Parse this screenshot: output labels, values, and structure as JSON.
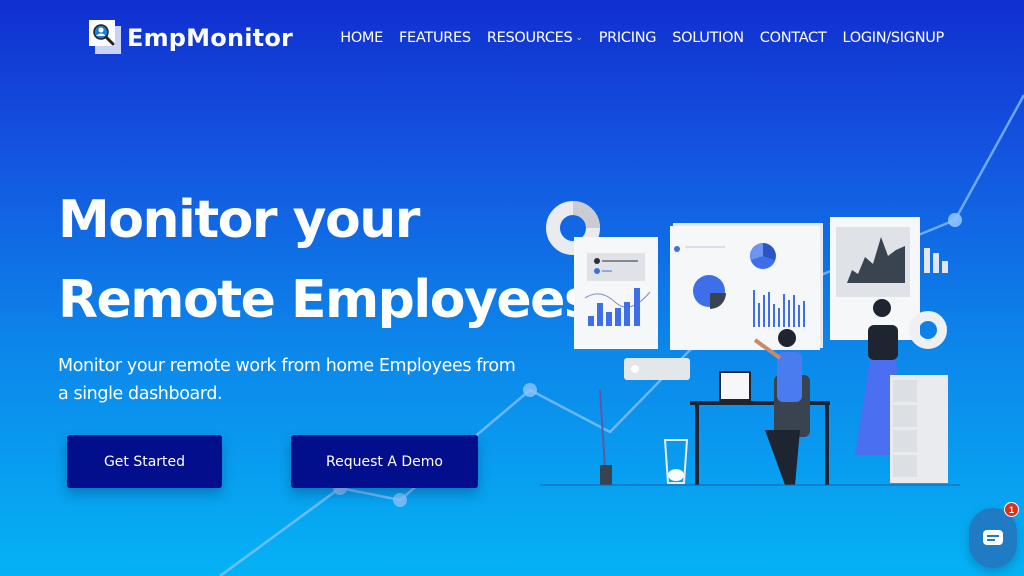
{
  "brand": {
    "name": "EmpMonitor",
    "logo_icon": "magnifier-user-icon"
  },
  "nav": {
    "items": [
      {
        "label": "HOME"
      },
      {
        "label": "FEATURES"
      },
      {
        "label": "RESOURCES",
        "has_dropdown": true
      },
      {
        "label": "PRICING"
      },
      {
        "label": "SOLUTION"
      },
      {
        "label": "CONTACT"
      },
      {
        "label": "LOGIN/SIGNUP"
      }
    ]
  },
  "hero": {
    "title_line1": "Monitor your",
    "title_line2": "Remote Employees",
    "subtitle": "Monitor your remote work from home Employees from a single dashboard.",
    "primary_button": "Get Started",
    "secondary_button": "Request A Demo"
  },
  "chat_widget": {
    "icon": "chat-bubble-icon",
    "badge_count": "1"
  },
  "colors": {
    "bg_top": "#102fd0",
    "bg_bottom": "#05b2f5",
    "button": "#030e8c",
    "accent_blue": "#4a7cf0",
    "badge": "#d6321b"
  }
}
